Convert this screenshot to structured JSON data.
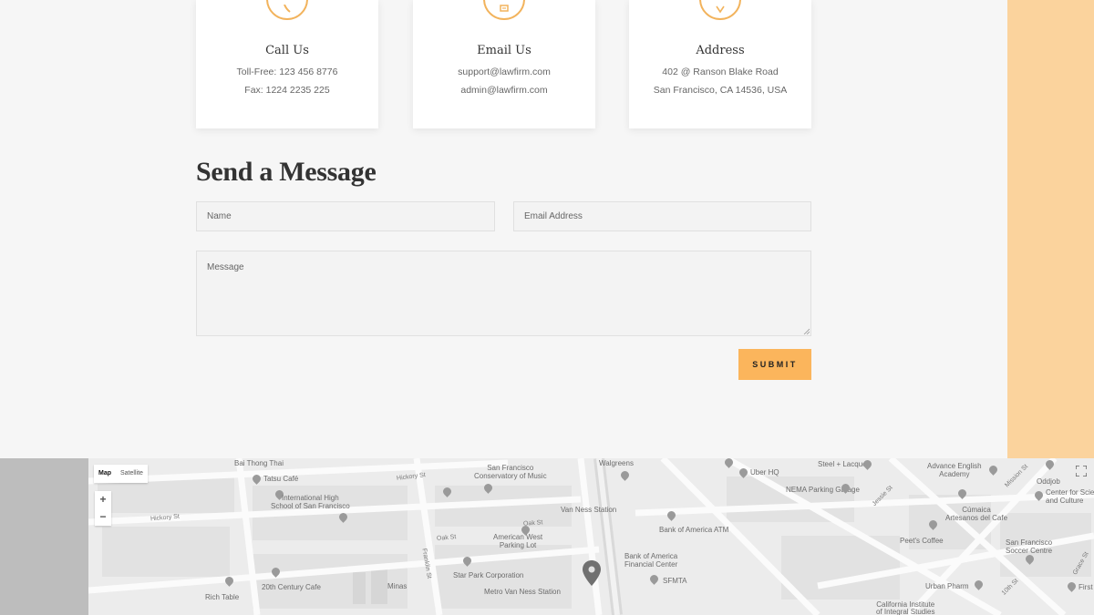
{
  "cards": [
    {
      "title": "Call Us",
      "line1": "Toll-Free: 123 456 8776",
      "line2": "Fax: 1224 2235 225",
      "icon": "phone-icon"
    },
    {
      "title": "Email Us",
      "line1": "support@lawfirm.com",
      "line2": "admin@lawfirm.com",
      "icon": "email-icon"
    },
    {
      "title": "Address",
      "line1": "402 @ Ranson Blake Road",
      "line2": "San Francisco, CA 14536, USA",
      "icon": "location-icon"
    }
  ],
  "form": {
    "title": "Send a Message",
    "name_placeholder": "Name",
    "email_placeholder": "Email Address",
    "message_placeholder": "Message",
    "submit_label": "SUBMIT"
  },
  "map": {
    "type_options": [
      "Map",
      "Satellite"
    ],
    "zoom_in": "+",
    "zoom_out": "−",
    "labels": {
      "bai_thong_thai": "Bai Thong Thai",
      "tatsu": "Tatsu Café",
      "intl_school": "International High\nSchool of San Francisco",
      "sf_conservatory": "San Francisco\nConservatory of Music",
      "walgreens": "Walgreens",
      "van_ness_station": "Van Ness Station",
      "american_west": "American West\nParking Lot",
      "star_park": "Star Park Corporation",
      "metro_van_ness": "Metro Van Ness Station",
      "twentieth_century": "20th Century Cafe",
      "minas": "Minas",
      "rich_table": "Rich Table",
      "uber_hq": "Uber HQ",
      "steel_lacquer": "Steel + Lacquer",
      "nema": "NEMA Parking Garage",
      "boa_atm": "Bank of America ATM",
      "boa_center": "Bank of America\nFinancial Center",
      "sfmta": "SFMTA",
      "advance_english": "Advance English\nAcademy",
      "oddjob": "Oddjob",
      "center_science": "Center for Science\nand Culture",
      "cumaica": "Cúmaica\nArtesanos del Cafe",
      "peets": "Peet's Coffee",
      "sf_soccer": "San Francisco\nSoccer Centre",
      "urban_pharm": "Urban Pharm",
      "ciis": "California Institute\nof Integral Studies",
      "first_republic": "First"
    },
    "streets": {
      "hickory": "Hickory St",
      "hickory2": "Hickory St",
      "oak": "Oak St",
      "oak2": "Oak St",
      "franklin": "Franklin St",
      "jessie": "Jessie St",
      "mission": "Mission St",
      "tenth": "10th St",
      "grace": "Grace St"
    }
  },
  "colors": {
    "accent": "#fbb55c",
    "peach": "#fbd39d",
    "background": "#f6f6f6"
  }
}
